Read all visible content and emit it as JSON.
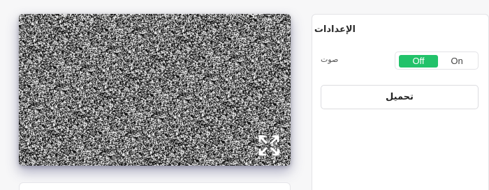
{
  "settings": {
    "title": "الإعدادات",
    "sound": {
      "label": "صوت",
      "options": [
        "Off",
        "On"
      ],
      "selected": "Off",
      "selected_color": "#22c26a"
    },
    "load_button": "تحميل"
  },
  "preview": {
    "expand_icon": "expand-arrows-icon"
  }
}
